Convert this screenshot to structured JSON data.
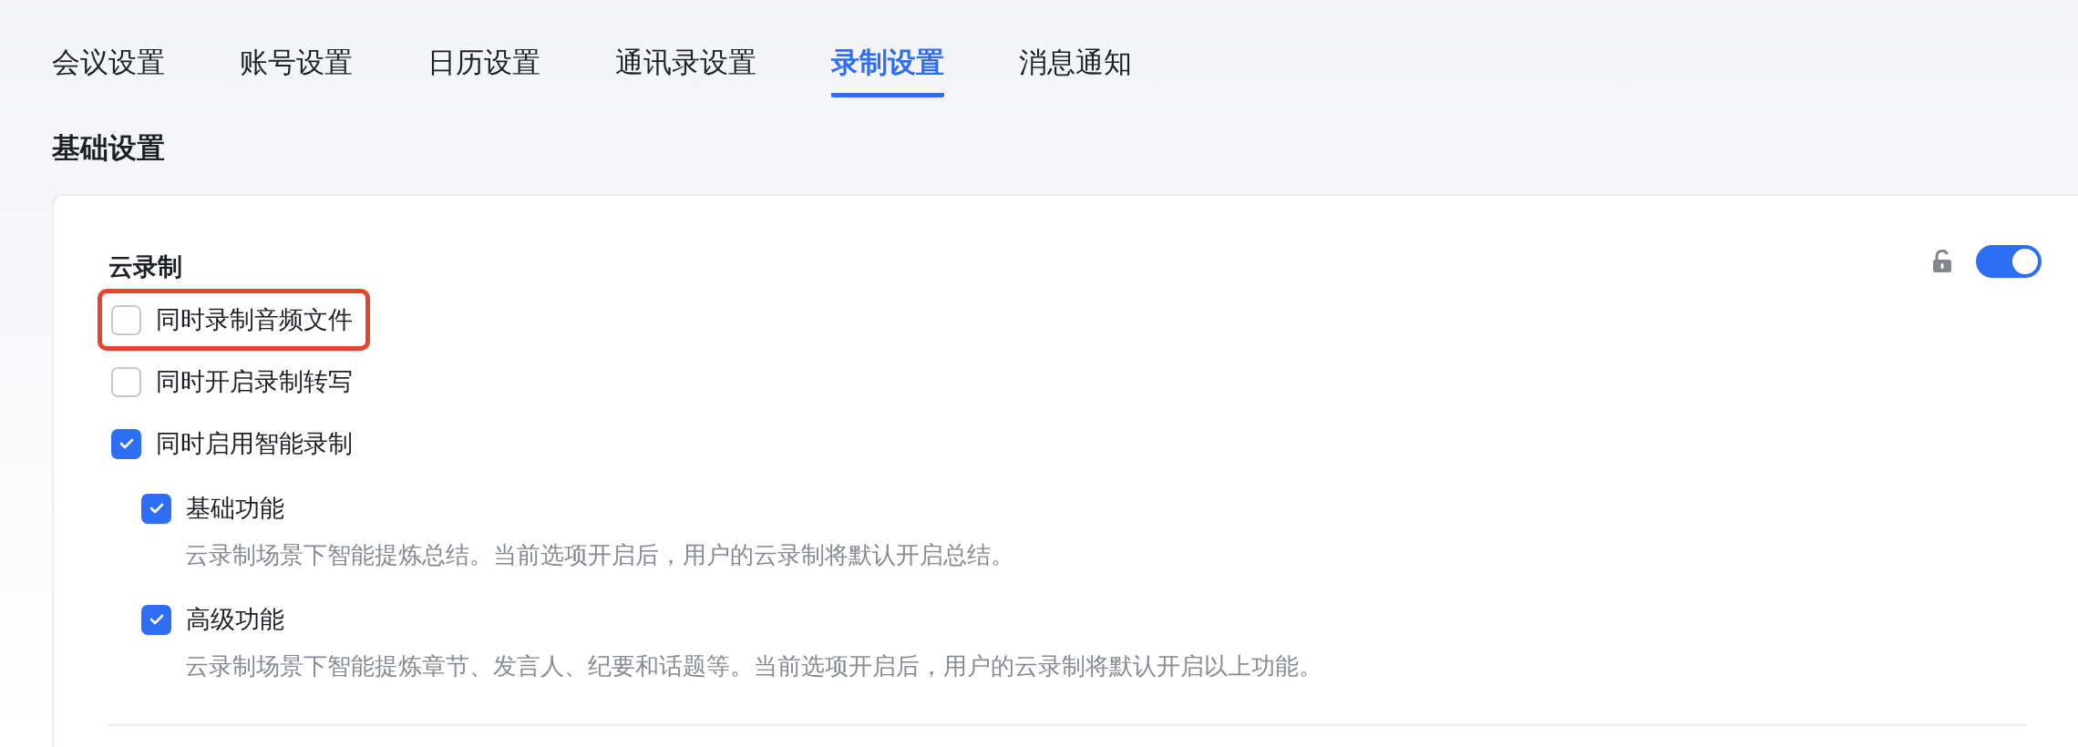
{
  "tabs": [
    {
      "label": "会议设置",
      "selected": false
    },
    {
      "label": "账号设置",
      "selected": false
    },
    {
      "label": "日历设置",
      "selected": false
    },
    {
      "label": "通讯录设置",
      "selected": false
    },
    {
      "label": "录制设置",
      "selected": true
    },
    {
      "label": "消息通知",
      "selected": false
    }
  ],
  "section_title": "基础设置",
  "card": {
    "title": "云录制",
    "locked": false,
    "on": true,
    "options": [
      {
        "label": "同时录制音频文件",
        "checked": false,
        "highlighted": true
      },
      {
        "label": "同时开启录制转写",
        "checked": false,
        "highlighted": false
      },
      {
        "label": "同时启用智能录制",
        "checked": true,
        "highlighted": false,
        "children": [
          {
            "label": "基础功能",
            "checked": true,
            "description": "云录制场景下智能提炼总结。当前选项开启后，用户的云录制将默认开启总结。"
          },
          {
            "label": "高级功能",
            "checked": true,
            "description": "云录制场景下智能提炼章节、发言人、纪要和话题等。当前选项开启后，用户的云录制将默认开启以上功能。"
          }
        ]
      }
    ]
  }
}
